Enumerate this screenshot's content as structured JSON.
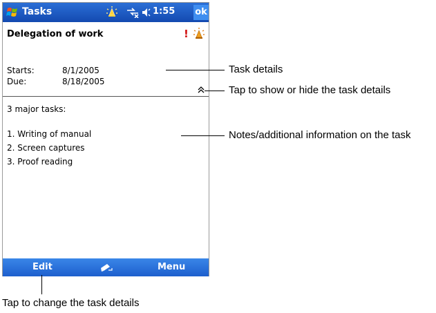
{
  "titlebar": {
    "app_title": "Tasks",
    "time": "1:55",
    "ok_label": "ok",
    "icons": [
      "windows-start-icon",
      "notification-icon",
      "connectivity-icon",
      "volume-icon"
    ]
  },
  "task": {
    "title": "Delegation of work",
    "priority_mark": "!",
    "starts_label": "Starts:",
    "starts_value": "8/1/2005",
    "due_label": "Due:",
    "due_value": "8/18/2005"
  },
  "notes": {
    "heading": "3 major tasks:",
    "items": [
      "1. Writing of manual",
      "2. Screen captures",
      "3. Proof reading"
    ]
  },
  "menubar": {
    "left": "Edit",
    "right": "Menu",
    "center_icon": "input-panel-icon"
  },
  "callouts": {
    "task_details": "Task details",
    "toggle_details": "Tap to show or hide the task details",
    "notes": "Notes/additional information on the task",
    "edit": "Tap to change the task details"
  },
  "colors": {
    "titlebar": "#1f5cc4",
    "menubar": "#2a72dc",
    "ok_button": "#3f8ef0",
    "priority": "#d01010"
  }
}
